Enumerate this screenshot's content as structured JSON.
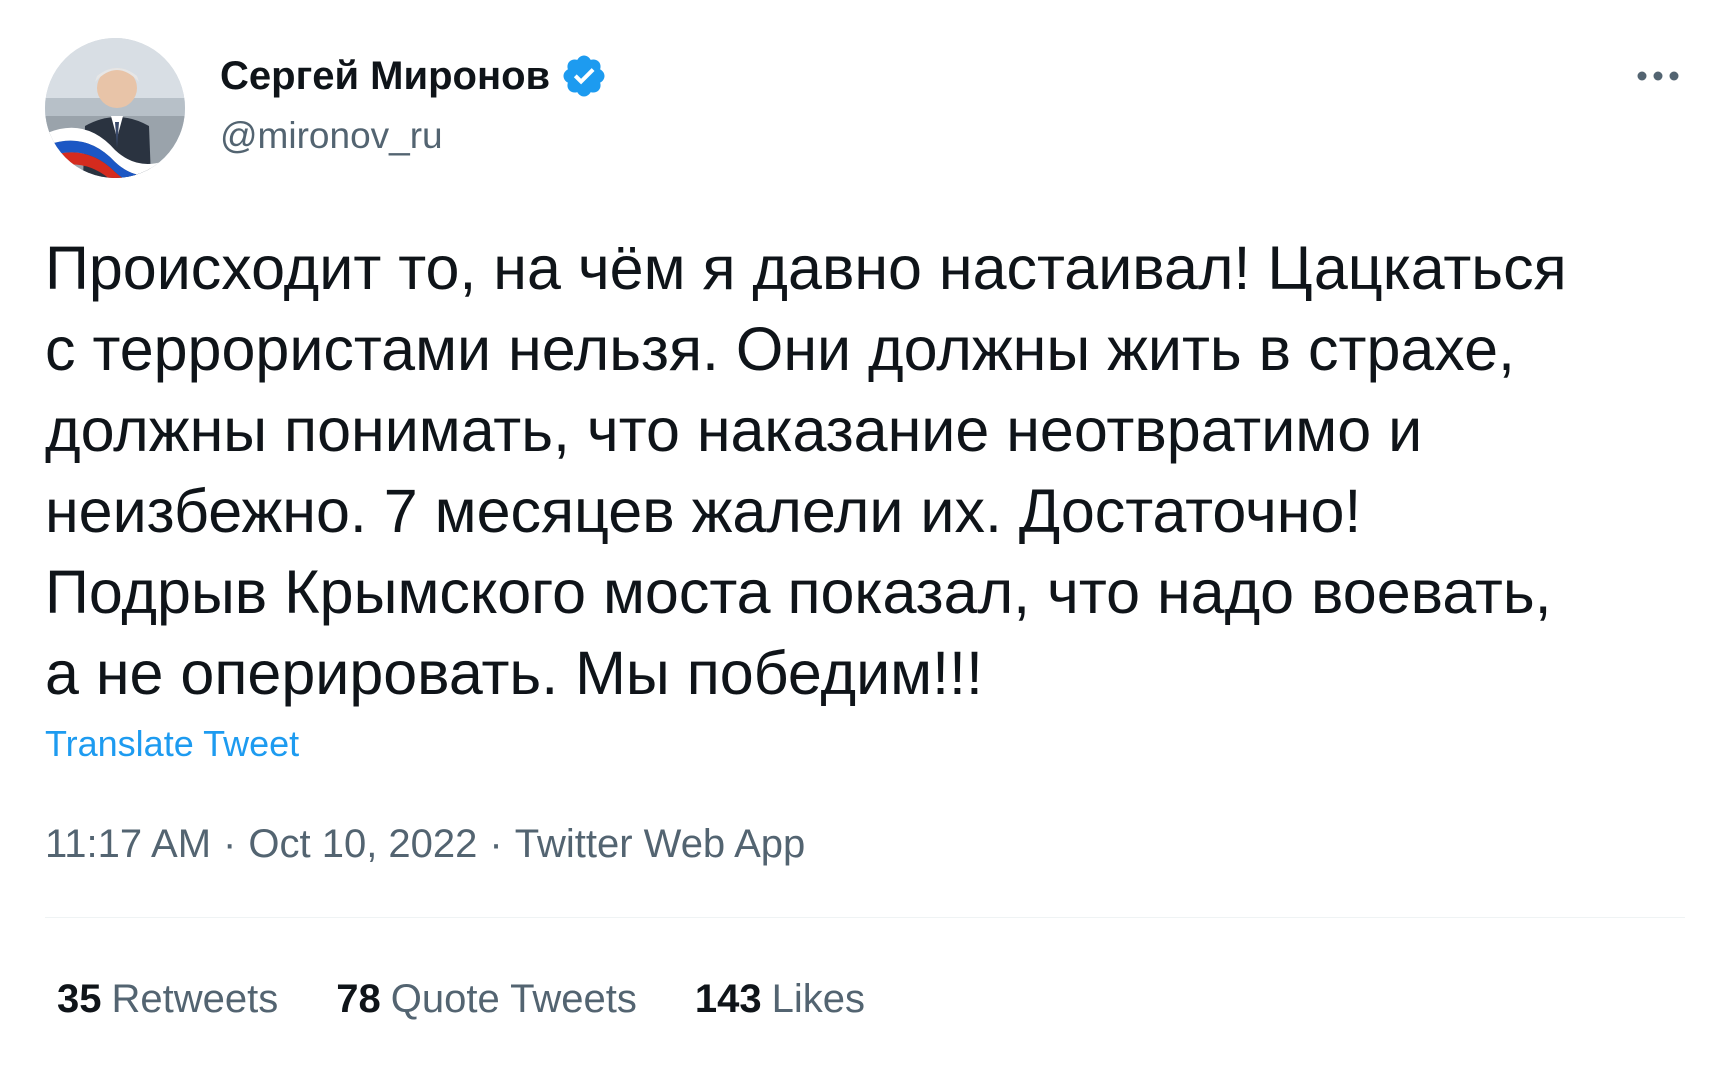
{
  "author": {
    "display_name": "Сергей Миронов",
    "handle": "@mironov_ru",
    "verified": true
  },
  "tweet": {
    "lines": [
      "Происходит то, на чём я давно настаивал! Цацкаться",
      "с террористами нельзя. Они должны жить в страхе,",
      "должны понимать, что наказание неотвратимо и",
      "неизбежно. 7 месяцев жалели их. Достаточно!",
      "Подрыв Крымского моста показал, что надо воевать,",
      "а не оперировать. Мы победим!!!"
    ],
    "translate_label": "Translate Tweet"
  },
  "meta": {
    "time": "11:17 AM",
    "separator": "·",
    "date": "Oct 10, 2022",
    "source": "Twitter Web App"
  },
  "stats": {
    "retweets": {
      "count": "35",
      "label": "Retweets"
    },
    "quote_tweets": {
      "count": "78",
      "label": "Quote Tweets"
    },
    "likes": {
      "count": "143",
      "label": "Likes"
    }
  },
  "colors": {
    "text": "#0f1419",
    "secondary": "#536471",
    "accent": "#1d9bf0",
    "divider": "#eff3f4"
  },
  "icons": {
    "verified": "verified-badge-icon",
    "more": "more-options-icon"
  }
}
